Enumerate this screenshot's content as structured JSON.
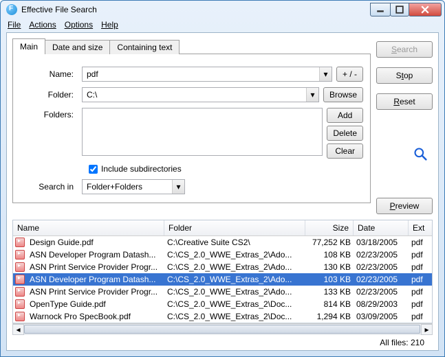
{
  "title": "Effective File Search",
  "menu": {
    "file": "File",
    "actions": "Actions",
    "options": "Options",
    "help": "Help"
  },
  "tabs": {
    "main": "Main",
    "date": "Date and size",
    "text": "Containing text"
  },
  "labels": {
    "name": "Name:",
    "folder": "Folder:",
    "folders": "Folders:",
    "include_sub": "Include subdirectories",
    "search_in": "Search in"
  },
  "fields": {
    "name_value": "pdf",
    "folder_value": "C:\\",
    "search_in_value": "Folder+Folders"
  },
  "buttons": {
    "plusminus": "+ / -",
    "browse": "Browse",
    "add": "Add",
    "delete": "Delete",
    "clear": "Clear",
    "search": "Search",
    "stop": "Stop",
    "reset": "Reset",
    "preview": "Preview"
  },
  "columns": {
    "name": "Name",
    "folder": "Folder",
    "size": "Size",
    "date": "Date",
    "ext": "Ext"
  },
  "rows": [
    {
      "name": "Design Guide.pdf",
      "folder": "C:\\Creative Suite CS2\\",
      "size": "77,252 KB",
      "date": "03/18/2005",
      "ext": "pdf",
      "sel": false
    },
    {
      "name": "ASN Developer Program Datash...",
      "folder": "C:\\CS_2.0_WWE_Extras_2\\Ado...",
      "size": "108 KB",
      "date": "02/23/2005",
      "ext": "pdf",
      "sel": false
    },
    {
      "name": "ASN Print Service Provider Progr...",
      "folder": "C:\\CS_2.0_WWE_Extras_2\\Ado...",
      "size": "130 KB",
      "date": "02/23/2005",
      "ext": "pdf",
      "sel": false
    },
    {
      "name": "ASN Developer Program Datash...",
      "folder": "C:\\CS_2.0_WWE_Extras_2\\Ado...",
      "size": "103 KB",
      "date": "02/23/2005",
      "ext": "pdf",
      "sel": true
    },
    {
      "name": "ASN Print Service Provider Progr...",
      "folder": "C:\\CS_2.0_WWE_Extras_2\\Ado...",
      "size": "133 KB",
      "date": "02/23/2005",
      "ext": "pdf",
      "sel": false
    },
    {
      "name": "OpenType Guide.pdf",
      "folder": "C:\\CS_2.0_WWE_Extras_2\\Doc...",
      "size": "814 KB",
      "date": "08/29/2003",
      "ext": "pdf",
      "sel": false
    },
    {
      "name": "Warnock Pro SpecBook.pdf",
      "folder": "C:\\CS_2.0_WWE_Extras_2\\Doc...",
      "size": "1,294 KB",
      "date": "03/09/2005",
      "ext": "pdf",
      "sel": false
    }
  ],
  "status": "All files: 210"
}
